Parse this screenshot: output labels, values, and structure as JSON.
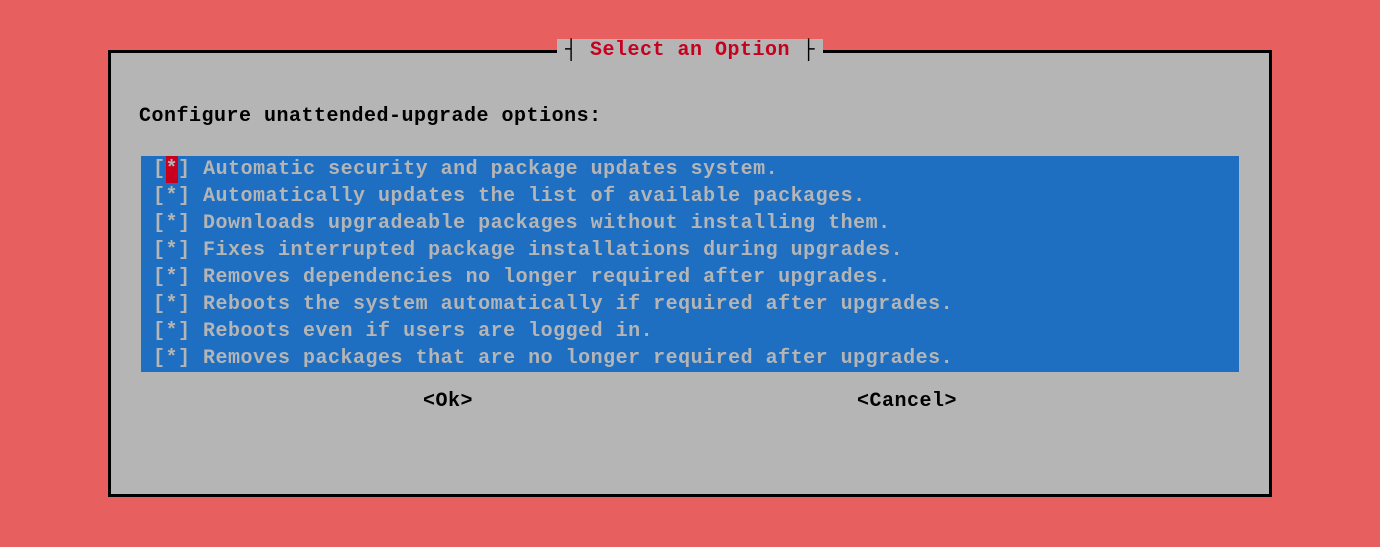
{
  "dialog": {
    "title": "Select an Option",
    "prompt": "Configure unattended-upgrade options:",
    "options": [
      {
        "checked": true,
        "label": "Automatic security and package updates system.",
        "cursor": true
      },
      {
        "checked": true,
        "label": "Automatically updates the list of available packages.",
        "cursor": false
      },
      {
        "checked": true,
        "label": "Downloads upgradeable packages without installing them.",
        "cursor": false
      },
      {
        "checked": true,
        "label": "Fixes interrupted package installations during upgrades.",
        "cursor": false
      },
      {
        "checked": true,
        "label": "Removes dependencies no longer required after upgrades.",
        "cursor": false
      },
      {
        "checked": true,
        "label": "Reboots the system automatically if required after upgrades.",
        "cursor": false
      },
      {
        "checked": true,
        "label": "Reboots even if users are logged in.",
        "cursor": false
      },
      {
        "checked": true,
        "label": "Removes packages that are no longer required after upgrades.",
        "cursor": false
      }
    ],
    "buttons": {
      "ok": "<Ok>",
      "cancel": "<Cancel>"
    }
  }
}
